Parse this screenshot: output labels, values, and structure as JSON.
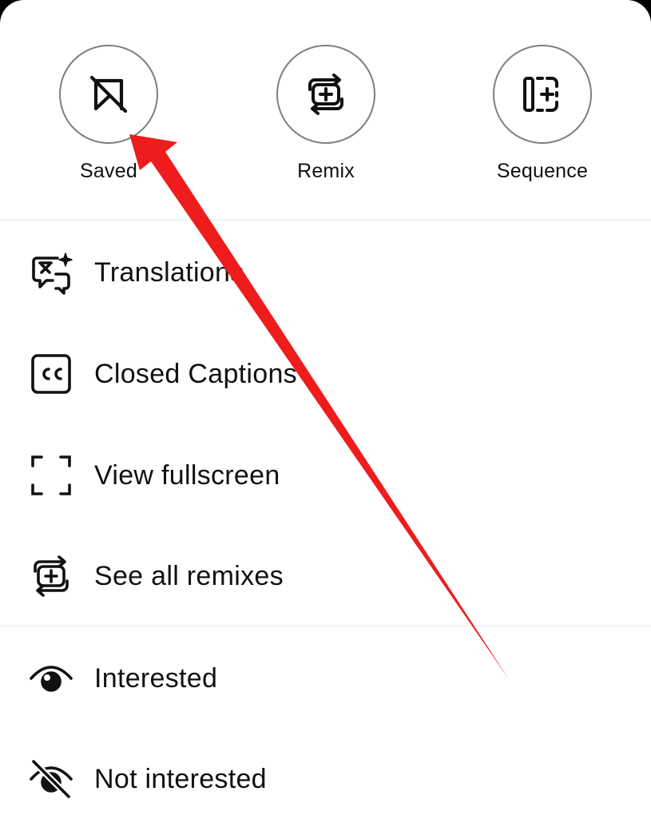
{
  "top_actions": [
    {
      "label": "Saved",
      "icon": "saved-off-icon"
    },
    {
      "label": "Remix",
      "icon": "remix-icon"
    },
    {
      "label": "Sequence",
      "icon": "sequence-icon"
    }
  ],
  "menu_items": [
    {
      "label": "Translations",
      "icon": "translations-icon"
    },
    {
      "label": "Closed Captions",
      "icon": "closed-captions-icon"
    },
    {
      "label": "View fullscreen",
      "icon": "fullscreen-icon"
    },
    {
      "label": "See all remixes",
      "icon": "remix-icon"
    },
    {
      "label": "Interested",
      "icon": "eye-icon"
    },
    {
      "label": "Not interested",
      "icon": "eye-off-icon"
    }
  ],
  "colors": {
    "annotation_arrow": "#ee1c1c",
    "text": "#111111",
    "circle_border": "#7b7f86",
    "divider": "#e6e6e6"
  }
}
